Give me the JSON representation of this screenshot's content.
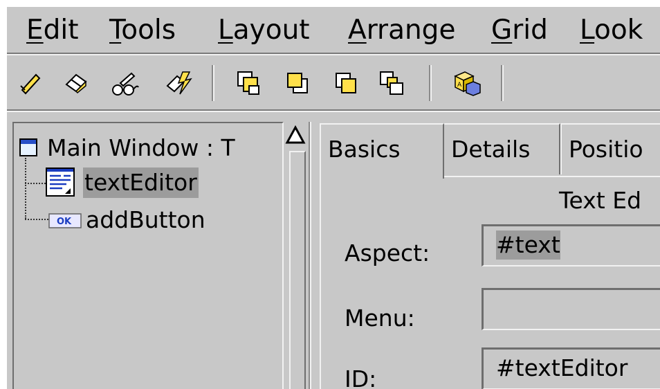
{
  "menubar": {
    "items": [
      {
        "mnemonic": "E",
        "rest": "dit"
      },
      {
        "mnemonic": "T",
        "rest": "ools"
      },
      {
        "mnemonic": "L",
        "rest": "ayout"
      },
      {
        "mnemonic": "A",
        "rest": "rrange"
      },
      {
        "mnemonic": "G",
        "rest": "rid"
      },
      {
        "mnemonic": "L",
        "rest": "ook"
      }
    ]
  },
  "toolbar": {
    "icons": [
      "pencil-check-icon",
      "eraser-icon",
      "glasses-inspect-icon",
      "lightning-pencil-icon",
      "bring-to-front-icon",
      "send-to-back-icon",
      "bring-forward-icon",
      "send-backward-icon",
      "component-cube-icon"
    ]
  },
  "tree": {
    "root": {
      "icon": "window-icon",
      "label": "Main Window : T"
    },
    "children": [
      {
        "icon": "text-editor-icon",
        "label": "textEditor",
        "selected": true
      },
      {
        "icon": "ok-button-icon",
        "label": "addButton",
        "selected": false
      }
    ]
  },
  "tabs": [
    {
      "label": "Basics",
      "active": true
    },
    {
      "label": "Details",
      "active": false
    },
    {
      "label": "Positio",
      "active": false
    }
  ],
  "panel": {
    "heading": "Text Ed",
    "aspect_label": "Aspect:",
    "aspect_value": "#text",
    "menu_label": "Menu:",
    "menu_value": "",
    "id_label": "ID:",
    "id_value": "#textEditor"
  },
  "colors": {
    "background": "#c8c8c8",
    "selection": "#9c9c9c"
  }
}
